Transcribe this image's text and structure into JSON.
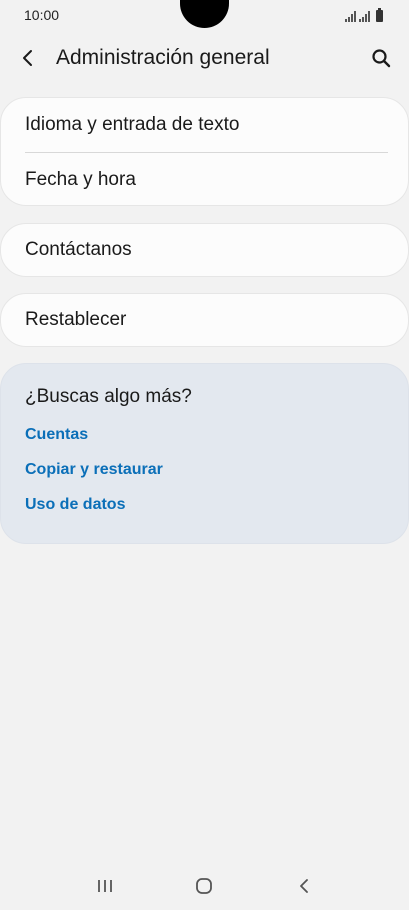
{
  "status_bar": {
    "time": "10:00"
  },
  "header": {
    "title": "Administración general",
    "back_icon": "chevron-left-icon",
    "search_icon": "search-icon"
  },
  "cards": [
    {
      "items": [
        "Idioma y entrada de texto",
        "Fecha y hora"
      ]
    },
    {
      "items": [
        "Contáctanos"
      ]
    },
    {
      "items": [
        "Restablecer"
      ]
    }
  ],
  "more": {
    "title": "¿Buscas algo más?",
    "links": [
      "Cuentas",
      "Copiar y restaurar",
      "Uso de datos"
    ],
    "link_color": "#0b6fb8",
    "background": "#e3e8ef"
  },
  "nav": {
    "recents_icon": "recent-apps-icon",
    "home_icon": "home-icon",
    "back_icon": "back-icon"
  }
}
